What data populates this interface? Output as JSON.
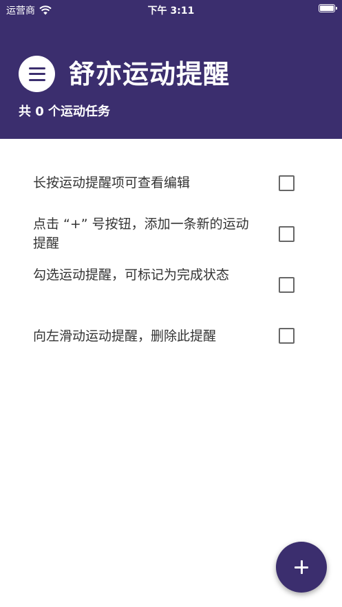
{
  "status_bar": {
    "carrier": "运营商",
    "time": "下午 3:11"
  },
  "header": {
    "title": "舒亦运动提醒",
    "task_count": "共 0 个运动任务"
  },
  "tasks": [
    {
      "text": "长按运动提醒项可查看编辑",
      "checked": false
    },
    {
      "text": "点击 “+” 号按钮，添加一条新的运动提醒",
      "checked": false
    },
    {
      "text": "勾选运动提醒，可标记为完成状态",
      "checked": false
    },
    {
      "text": "向左滑动运动提醒，删除此提醒",
      "checked": false
    }
  ],
  "icons": {
    "menu": "menu-icon",
    "add": "plus-icon",
    "wifi": "wifi-icon",
    "battery": "battery-icon"
  },
  "colors": {
    "primary": "#3b2e6e",
    "text": "#333333",
    "checkbox_border": "#666666"
  }
}
